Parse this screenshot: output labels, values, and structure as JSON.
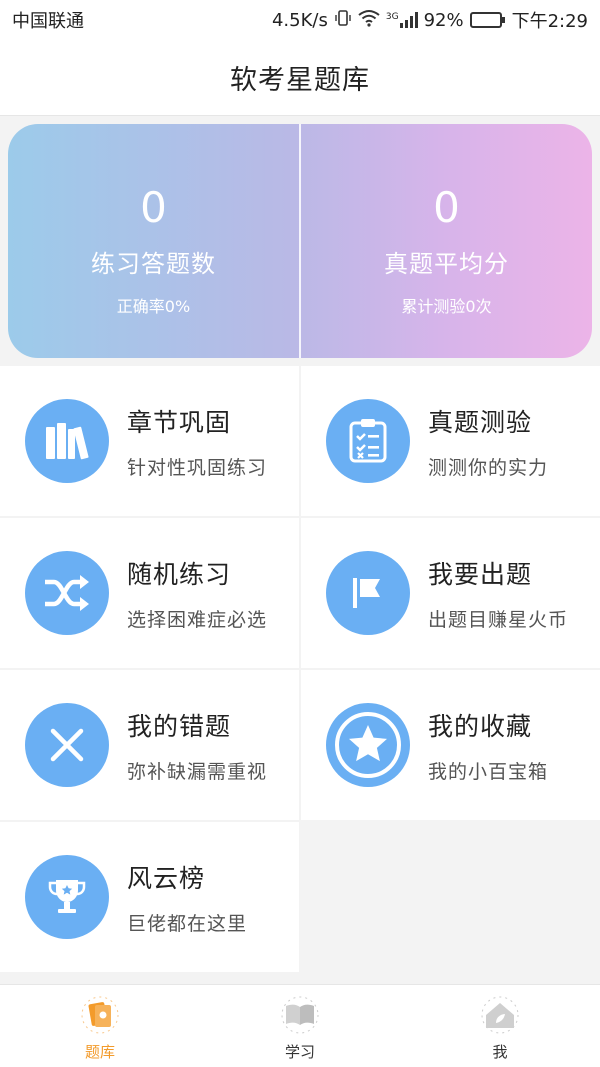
{
  "status_bar": {
    "carrier": "中国联通",
    "speed": "4.5K/s",
    "network": "3G",
    "battery": "92%",
    "time": "下午2:29"
  },
  "header": {
    "title": "软考星题库"
  },
  "stats": {
    "left": {
      "value": "0",
      "label": "练习答题数",
      "sub": "正确率0%"
    },
    "right": {
      "value": "0",
      "label": "真题平均分",
      "sub": "累计测验0次"
    }
  },
  "menu": [
    {
      "name": "章节巩固",
      "desc": "针对性巩固练习",
      "icon": "books-icon"
    },
    {
      "name": "真题测验",
      "desc": "测测你的实力",
      "icon": "clipboard-checklist-icon"
    },
    {
      "name": "随机练习",
      "desc": "选择困难症必选",
      "icon": "shuffle-icon"
    },
    {
      "name": "我要出题",
      "desc": "出题目赚星火币",
      "icon": "flag-icon"
    },
    {
      "name": "我的错题",
      "desc": "弥补缺漏需重视",
      "icon": "close-x-icon"
    },
    {
      "name": "我的收藏",
      "desc": "我的小百宝箱",
      "icon": "star-icon"
    },
    {
      "name": "风云榜",
      "desc": "巨佬都在这里",
      "icon": "trophy-icon"
    }
  ],
  "bottom_nav": [
    {
      "label": "题库",
      "icon": "question-bank-icon",
      "active": true
    },
    {
      "label": "学习",
      "icon": "open-book-icon",
      "active": false
    },
    {
      "label": "我",
      "icon": "home-leaf-icon",
      "active": false
    }
  ],
  "colors": {
    "accent_blue": "#6aaff3",
    "active_orange": "#f39b2b",
    "card_gradient_start": "#9ccbea",
    "card_gradient_end": "#ecb4e8"
  }
}
